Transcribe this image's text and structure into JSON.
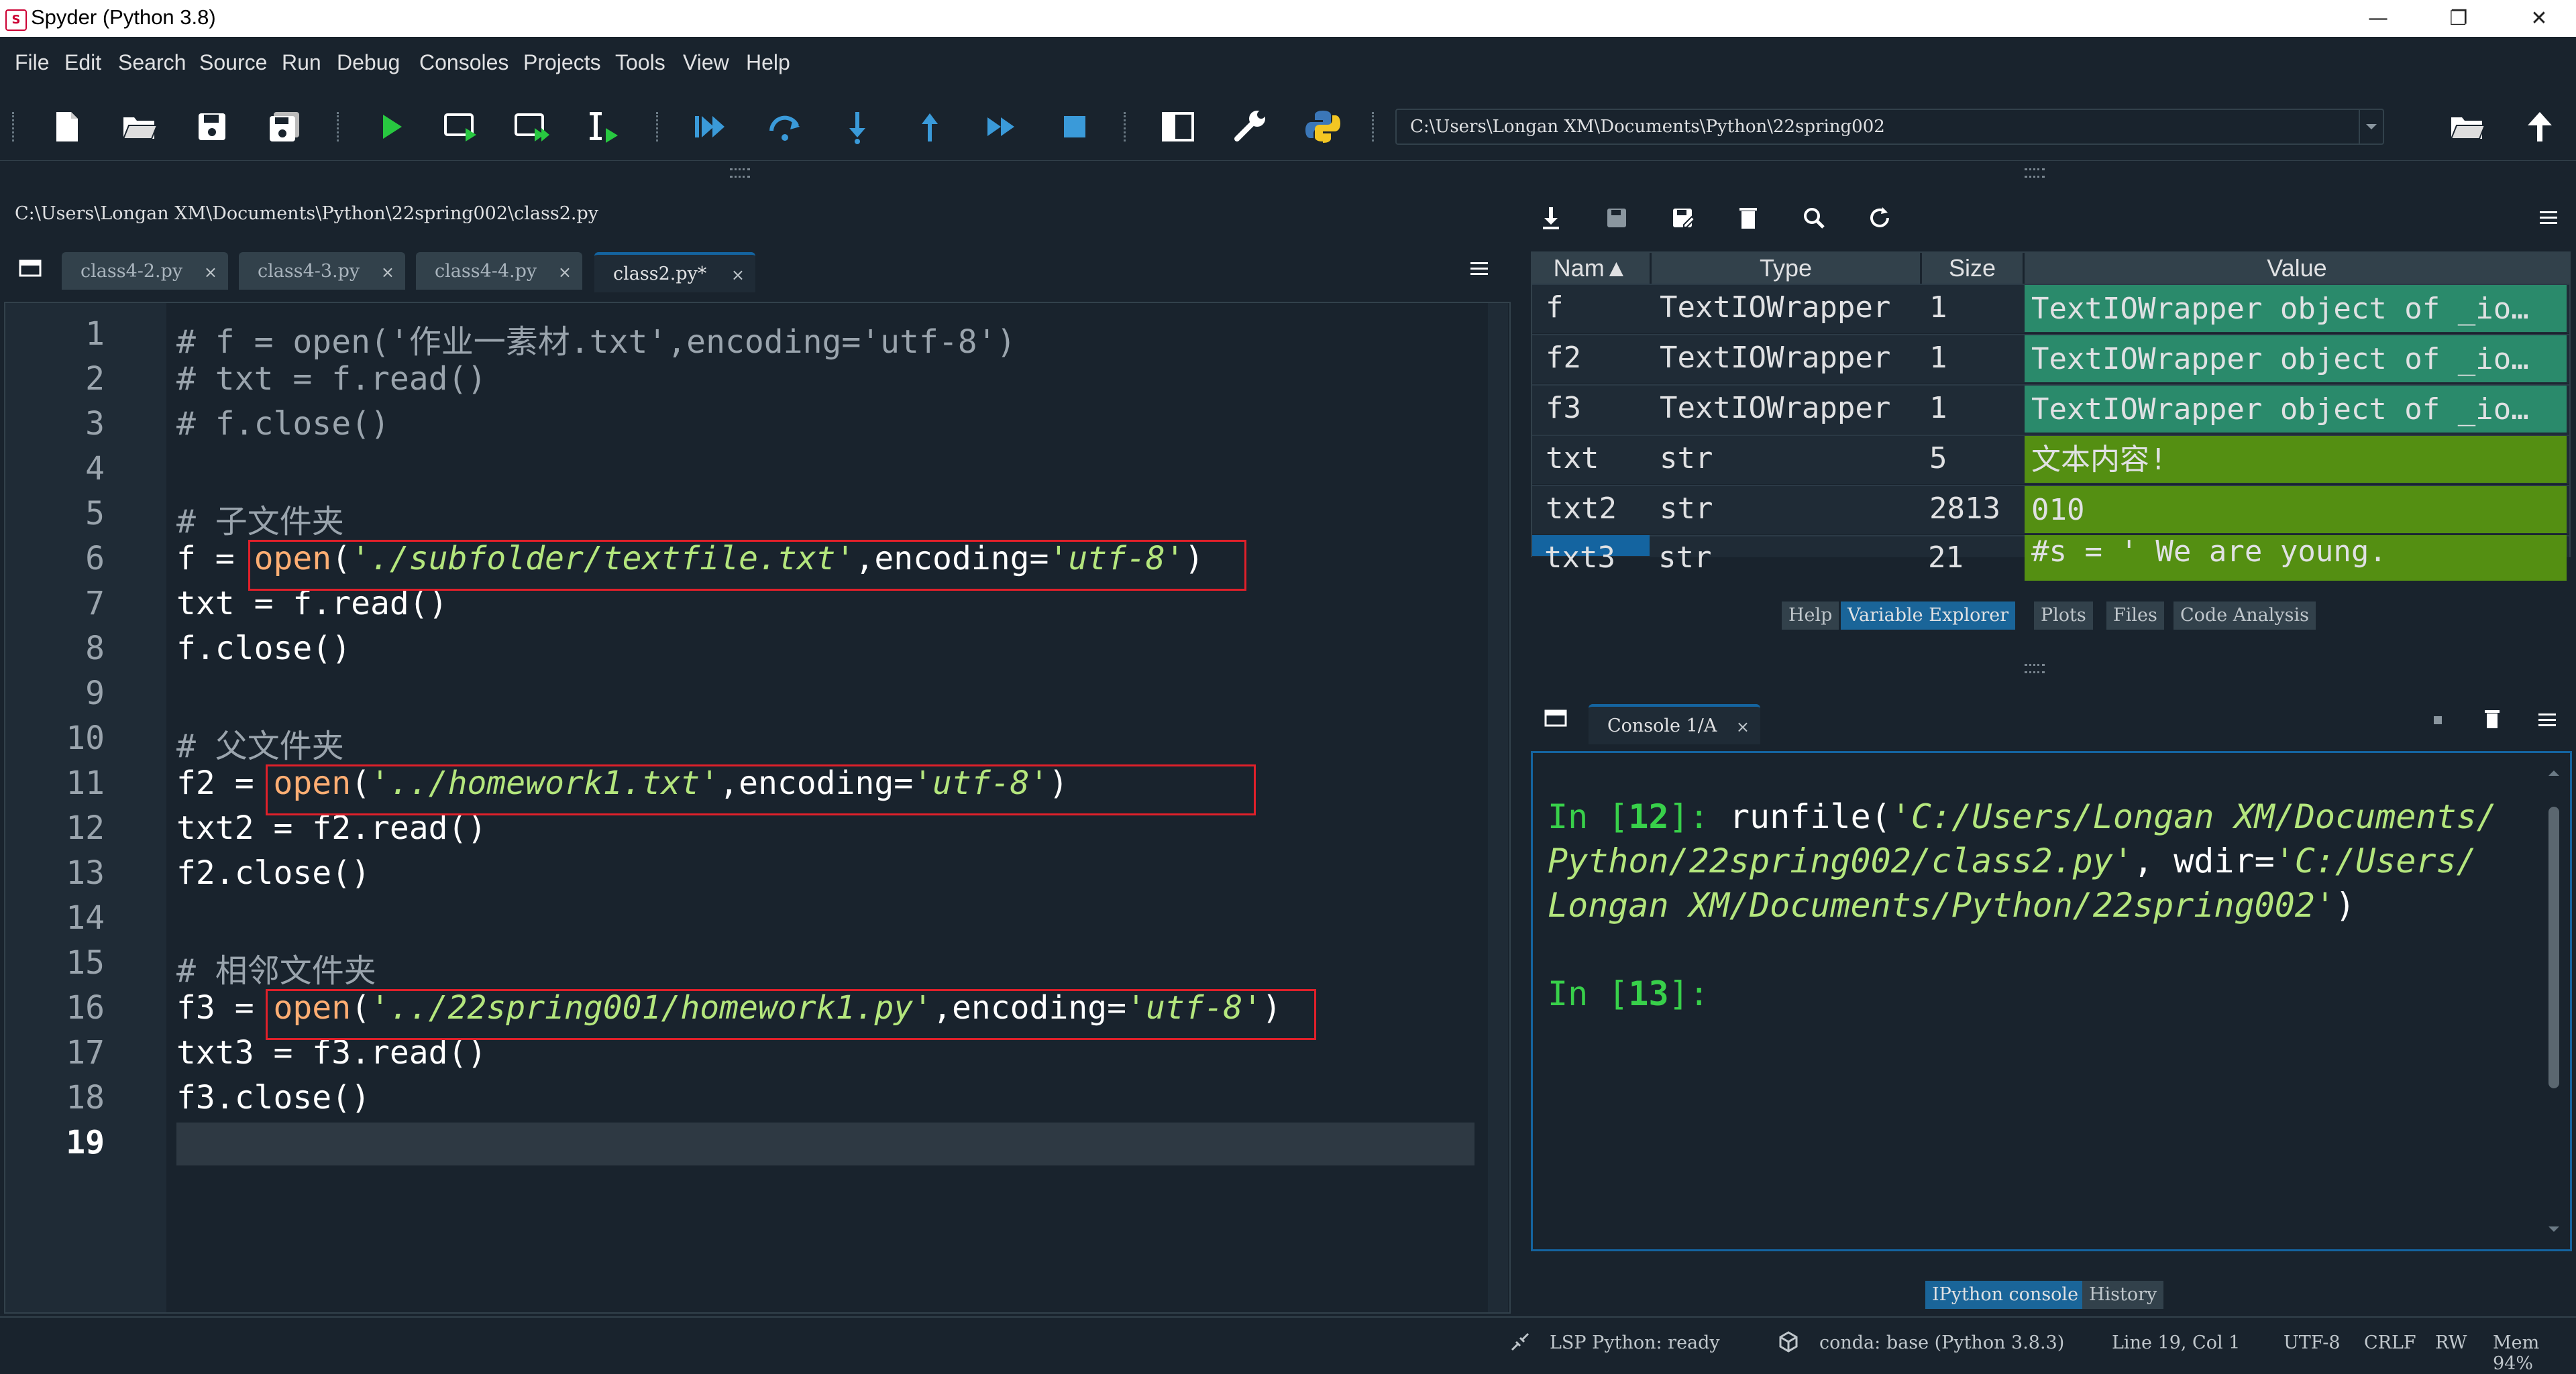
{
  "window": {
    "title": "Spyder (Python 3.8)",
    "minimize": "—",
    "maximize": "❐",
    "close": "✕"
  },
  "menu": [
    "File",
    "Edit",
    "Search",
    "Source",
    "Run",
    "Debug",
    "Consoles",
    "Projects",
    "Tools",
    "View",
    "Help"
  ],
  "toolbar": {
    "icons": [
      "new-file-icon",
      "open-file-icon",
      "save-icon",
      "save-all-icon",
      "run-icon",
      "run-cell-icon",
      "run-cell-advance-icon",
      "run-selection-icon",
      "debug-icon",
      "step-icon",
      "step-into-icon",
      "step-return-icon",
      "continue-icon",
      "stop-icon",
      "maximize-pane-icon",
      "preferences-icon",
      "python-path-icon"
    ],
    "working_dir": "C:\\Users\\Longan XM\\Documents\\Python\\22spring002"
  },
  "editor": {
    "file_path": "C:\\Users\\Longan XM\\Documents\\Python\\22spring002\\class2.py",
    "tabs": [
      {
        "label": "class4-2.py",
        "active": false
      },
      {
        "label": "class4-3.py",
        "active": false
      },
      {
        "label": "class4-4.py",
        "active": false
      },
      {
        "label": "class2.py*",
        "active": true
      }
    ],
    "tab_close": "×",
    "line_numbers": [
      "1",
      "2",
      "3",
      "4",
      "5",
      "6",
      "7",
      "8",
      "9",
      "10",
      "11",
      "12",
      "13",
      "14",
      "15",
      "16",
      "17",
      "18",
      "19"
    ],
    "current_line": "19",
    "lines": {
      "l1": "# f = open('作业一素材.txt',encoding='utf-8')",
      "l2": "# txt = f.read()",
      "l3": "# f.close()",
      "l5": "# 子文件夹",
      "l6a": "f = ",
      "l6b": "open",
      "l6c": "(",
      "l6d": "'./subfolder/textfile.txt'",
      "l6e": ",encoding=",
      "l6f": "'utf-8'",
      "l6g": ")",
      "l7": "txt = f.read()",
      "l8": "f.close()",
      "l10": "# 父文件夹",
      "l11a": "f2 = ",
      "l11b": "open",
      "l11c": "(",
      "l11d": "'../homework1.txt'",
      "l11e": ",encoding=",
      "l11f": "'utf-8'",
      "l11g": ")",
      "l12": "txt2 = f2.read()",
      "l13": "f2.close()",
      "l15": "# 相邻文件夹",
      "l16a": "f3 = ",
      "l16b": "open",
      "l16c": "(",
      "l16d": "'../22spring001/homework1.py'",
      "l16e": ",encoding=",
      "l16f": "'utf-8'",
      "l16g": ")",
      "l17": "txt3 = f3.read()",
      "l18": "f3.close()"
    }
  },
  "variable_explorer": {
    "columns": [
      "Nam▲",
      "Type",
      "Size",
      "Value"
    ],
    "rows": [
      {
        "name": "f",
        "type": "TextIOWrapper",
        "size": "1",
        "value": "TextIOWrapper object of _io…"
      },
      {
        "name": "f2",
        "type": "TextIOWrapper",
        "size": "1",
        "value": "TextIOWrapper object of _io…"
      },
      {
        "name": "f3",
        "type": "TextIOWrapper",
        "size": "1",
        "value": "TextIOWrapper object of _io…"
      },
      {
        "name": "txt",
        "type": "str",
        "size": "5",
        "value": "文本内容!"
      },
      {
        "name": "txt2",
        "type": "str",
        "size": "2813",
        "value": "010"
      },
      {
        "name": "txt3",
        "type": "str",
        "size": "21",
        "value": "#s = ' We are young."
      }
    ],
    "bottom_tabs": [
      "Help",
      "Variable Explorer",
      "Plots",
      "Files",
      "Code Analysis"
    ]
  },
  "console": {
    "tab_label": "Console 1/A",
    "line1_prompt": "In [",
    "line1_num": "12",
    "line1_close": "]: ",
    "line1_cmd": "runfile(",
    "line1_arg1": "'C:/Users/Longan XM/Documents/",
    "line2": "Python/22spring002/class2.py'",
    "line2_b": ", wdir=",
    "line2_c": "'C:/Users/",
    "line3": "Longan XM/Documents/Python/22spring002'",
    "line3_b": ")",
    "line4_prompt": "In [",
    "line4_num": "13",
    "line4_close": "]:",
    "bottom_tabs": [
      "IPython console",
      "History"
    ]
  },
  "status": {
    "lsp": "LSP Python: ready",
    "conda": "conda: base (Python 3.8.3)",
    "position": "Line 19, Col 1",
    "encoding": "UTF-8",
    "eol": "CRLF",
    "rw": "RW",
    "mem": "Mem 94%"
  },
  "colors": {
    "bg": "#19232d",
    "accent": "#1464a0",
    "highlight_box": "#e0202a",
    "teal_cell": "#2a8a6b",
    "olive_cell": "#548f12"
  }
}
